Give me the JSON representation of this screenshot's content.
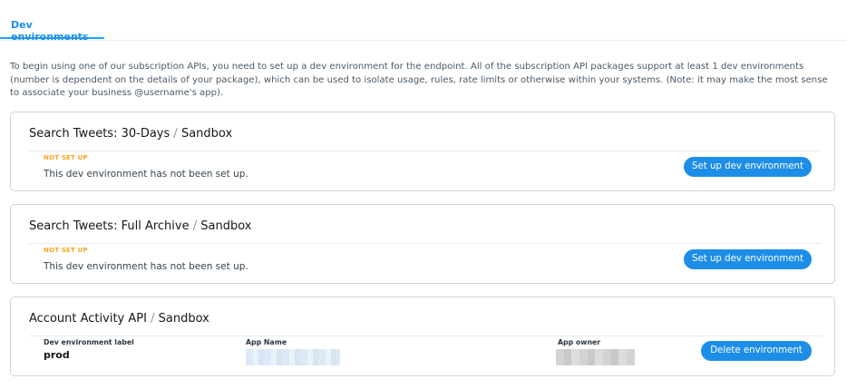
{
  "tabs": [
    {
      "label": "Dev environments",
      "active": true
    }
  ],
  "intro": {
    "text": "To begin using one of our subscription APIs, you need to set up a dev environment for the endpoint. All of the subscription API packages support at least 1 dev environments (number is dependent on the details of your package), which can be used to isolate usage, rules, rate limits or otherwise within your systems. (Note: it may make the most sense to associate your business @username's app)."
  },
  "colors": {
    "accent": "#1d8ee8",
    "status_not_set_up": "#f5a623",
    "border": "#ccd6dd"
  },
  "environments": [
    {
      "product": "Search Tweets: 30-Days",
      "separator": "/",
      "tier": "Sandbox",
      "status": "NOT SET UP",
      "message": "This dev environment has not been set up.",
      "button": "Set up dev environment"
    },
    {
      "product": "Search Tweets: Full Archive",
      "separator": "/",
      "tier": "Sandbox",
      "status": "NOT SET UP",
      "message": "This dev environment has not been set up.",
      "button": "Set up dev environment"
    },
    {
      "product": "Account Activity API",
      "separator": "/",
      "tier": "Sandbox",
      "fields": {
        "label_header": "Dev environment label",
        "label_value": "prod",
        "app_name_header": "App Name",
        "app_owner_header": "App owner"
      },
      "button": "Delete environment"
    }
  ]
}
